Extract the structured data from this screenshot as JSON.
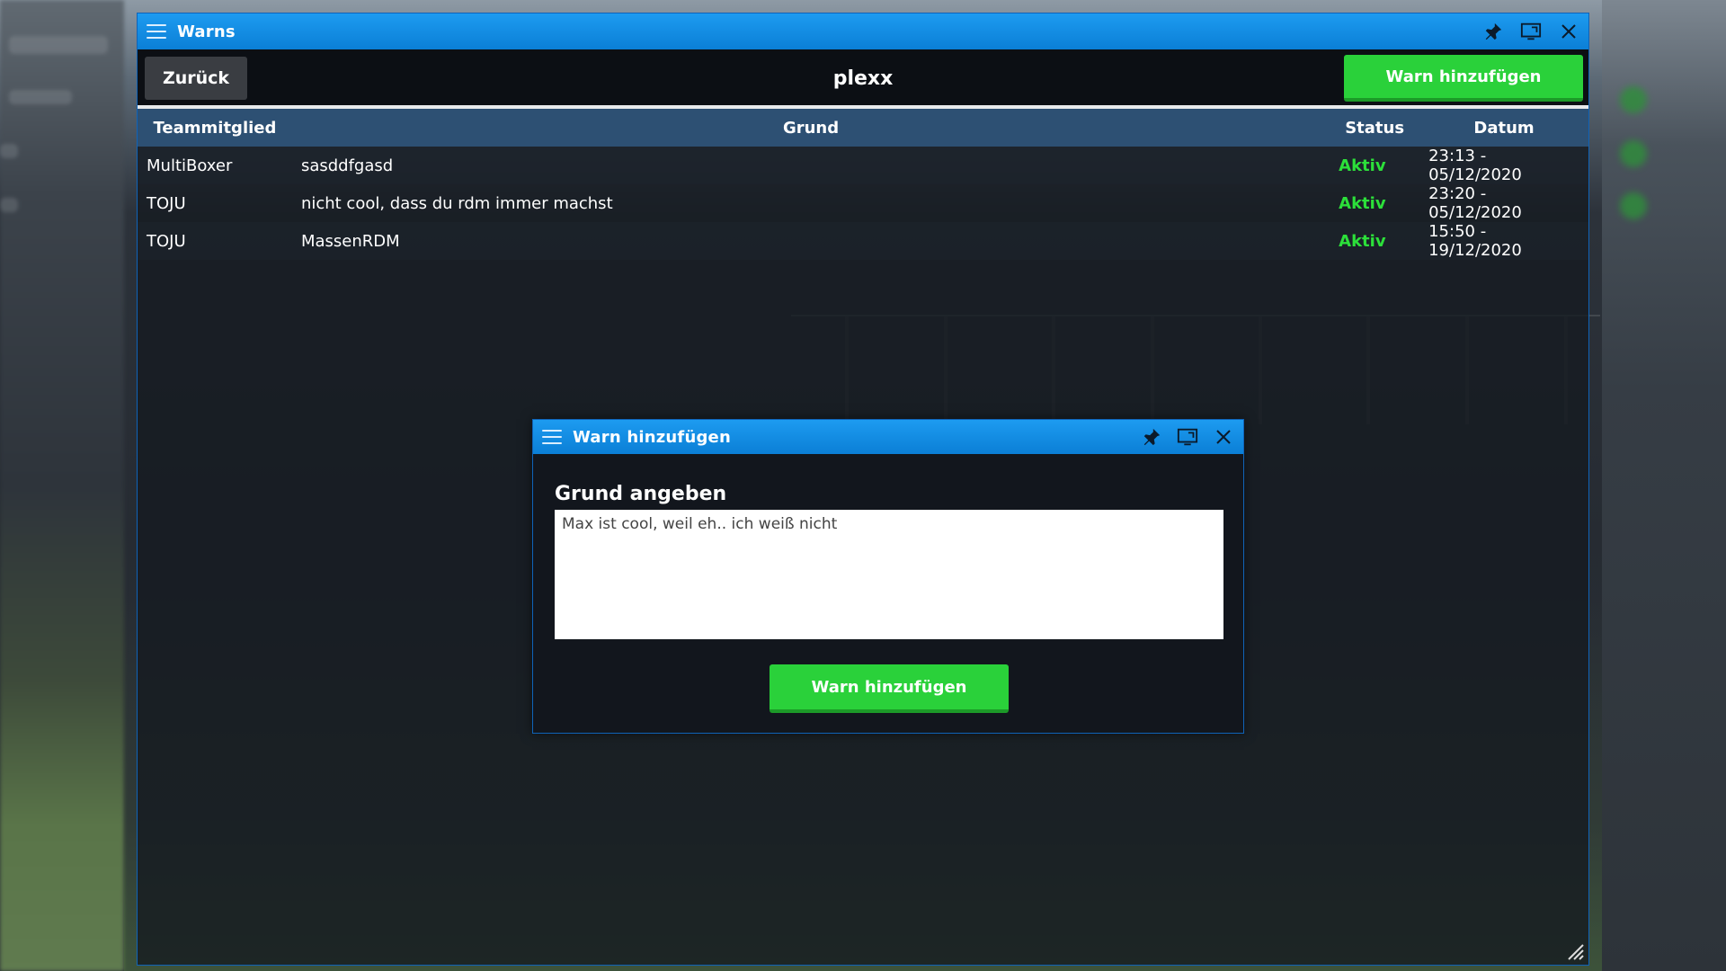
{
  "main_window": {
    "title": "Warns",
    "back_label": "Zurück",
    "player_name": "plexx",
    "add_warn_label": "Warn hinzufügen",
    "columns": {
      "member": "Teammitglied",
      "reason": "Grund",
      "status": "Status",
      "date": "Datum"
    },
    "rows": [
      {
        "member": "MultiBoxer",
        "reason": "sasddfgasd",
        "status": "Aktiv",
        "date": "23:13 - 05/12/2020"
      },
      {
        "member": "TOJU",
        "reason": "nicht cool, dass du rdm immer machst",
        "status": "Aktiv",
        "date": "23:20 - 05/12/2020"
      },
      {
        "member": "TOJU",
        "reason": "MassenRDM",
        "status": "Aktiv",
        "date": "15:50 - 19/12/2020"
      }
    ]
  },
  "dialog": {
    "title": "Warn hinzufügen",
    "prompt": "Grund angeben",
    "reason_value": "Max ist cool, weil eh.. ich weiß nicht",
    "submit_label": "Warn hinzufügen"
  },
  "colors": {
    "titlebar": "#1d9bf0",
    "accent_green": "#2ad13a",
    "status_active": "#2ce03a",
    "table_header": "#2d5073"
  },
  "icons": [
    "menu-icon",
    "pin-icon",
    "maximize-icon",
    "close-icon",
    "resize-grip-icon"
  ]
}
